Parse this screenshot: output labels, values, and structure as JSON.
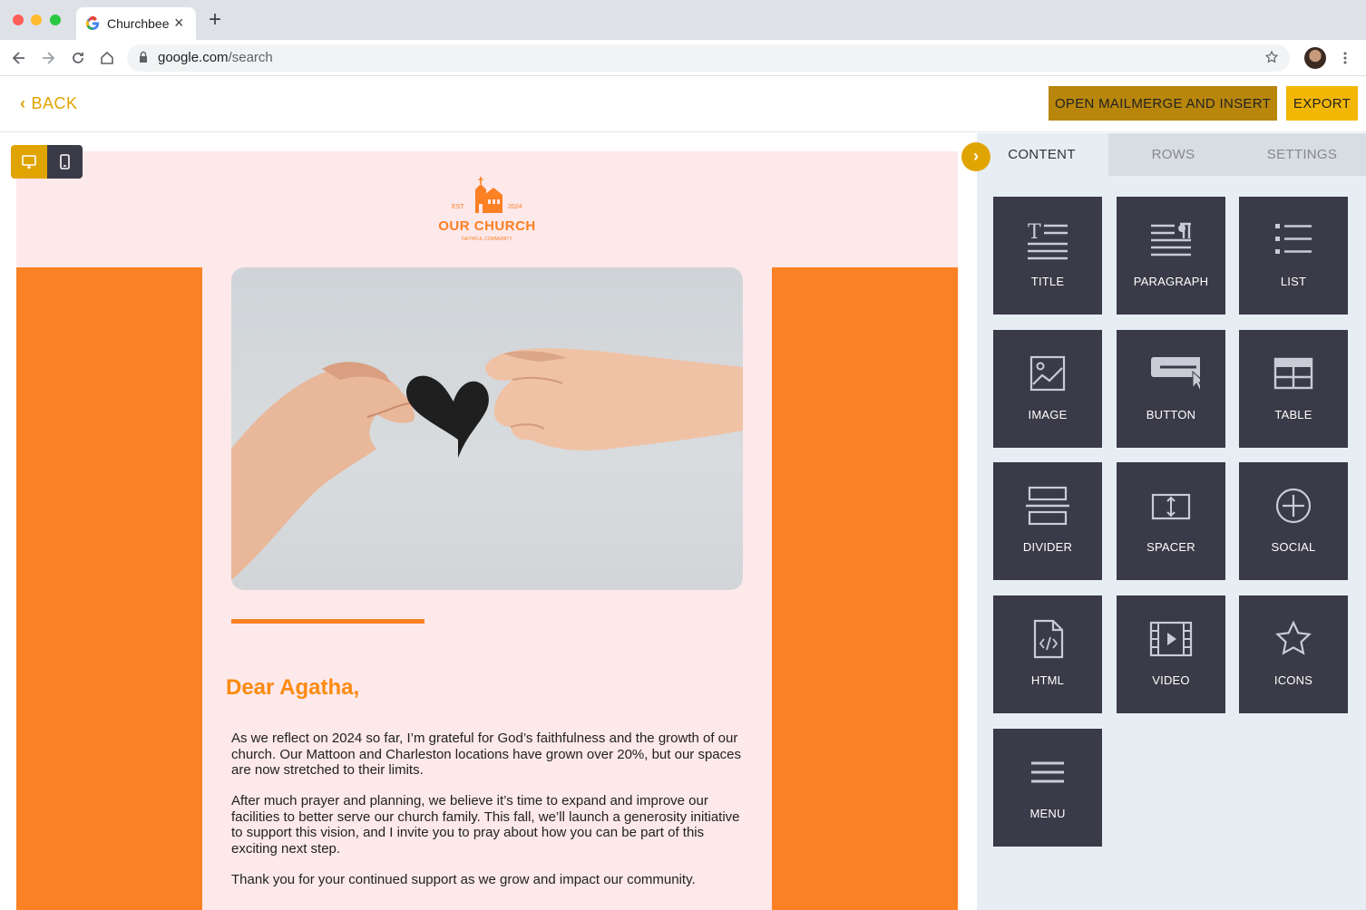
{
  "browser": {
    "tab_title": "Churchbee",
    "url_domain": "google.com",
    "url_path": "/search"
  },
  "header": {
    "back_label": "BACK",
    "merge_label": "OPEN MAILMERGE AND INSERT",
    "export_label": "EXPORT"
  },
  "email": {
    "logo": {
      "est": "EST.",
      "year": "2024",
      "name": "OUR CHURCH",
      "tagline": "FAITHFUL COMMUNITY"
    },
    "greeting": "Dear Agatha,",
    "paragraphs": [
      "As we reflect on 2024 so far, I’m grateful for God’s faithfulness and the growth of our church. Our Mattoon and Charleston locations have grown over 20%, but our spaces are now stretched to their limits.",
      "After much prayer and planning, we believe it’s time to expand and improve our facilities to better serve our church family. This fall, we’ll launch a generosity initiative to support this vision, and I invite you to pray about how you can be part of this exciting next step.",
      "Thank you for your continued support as we grow and impact our community."
    ]
  },
  "panel": {
    "tabs": [
      "CONTENT",
      "ROWS",
      "SETTINGS"
    ],
    "active_tab": "CONTENT",
    "tiles": [
      {
        "label": "TITLE",
        "icon": "title-icon"
      },
      {
        "label": "PARAGRAPH",
        "icon": "paragraph-icon"
      },
      {
        "label": "LIST",
        "icon": "list-icon"
      },
      {
        "label": "IMAGE",
        "icon": "image-icon"
      },
      {
        "label": "BUTTON",
        "icon": "button-icon"
      },
      {
        "label": "TABLE",
        "icon": "table-icon"
      },
      {
        "label": "DIVIDER",
        "icon": "divider-icon"
      },
      {
        "label": "SPACER",
        "icon": "spacer-icon"
      },
      {
        "label": "SOCIAL",
        "icon": "social-icon"
      },
      {
        "label": "HTML",
        "icon": "html-icon"
      },
      {
        "label": "VIDEO",
        "icon": "video-icon"
      },
      {
        "label": "ICONS",
        "icon": "star-icon"
      },
      {
        "label": "MENU",
        "icon": "menu-icon"
      }
    ]
  },
  "colors": {
    "accent": "#e0a400",
    "merge_button": "#b8860b",
    "export_button": "#f2b705",
    "email_orange": "#fc8024",
    "email_pink": "#fde8ea",
    "tile_bg": "#3a3a48",
    "panel_bg": "#e6eef4"
  }
}
